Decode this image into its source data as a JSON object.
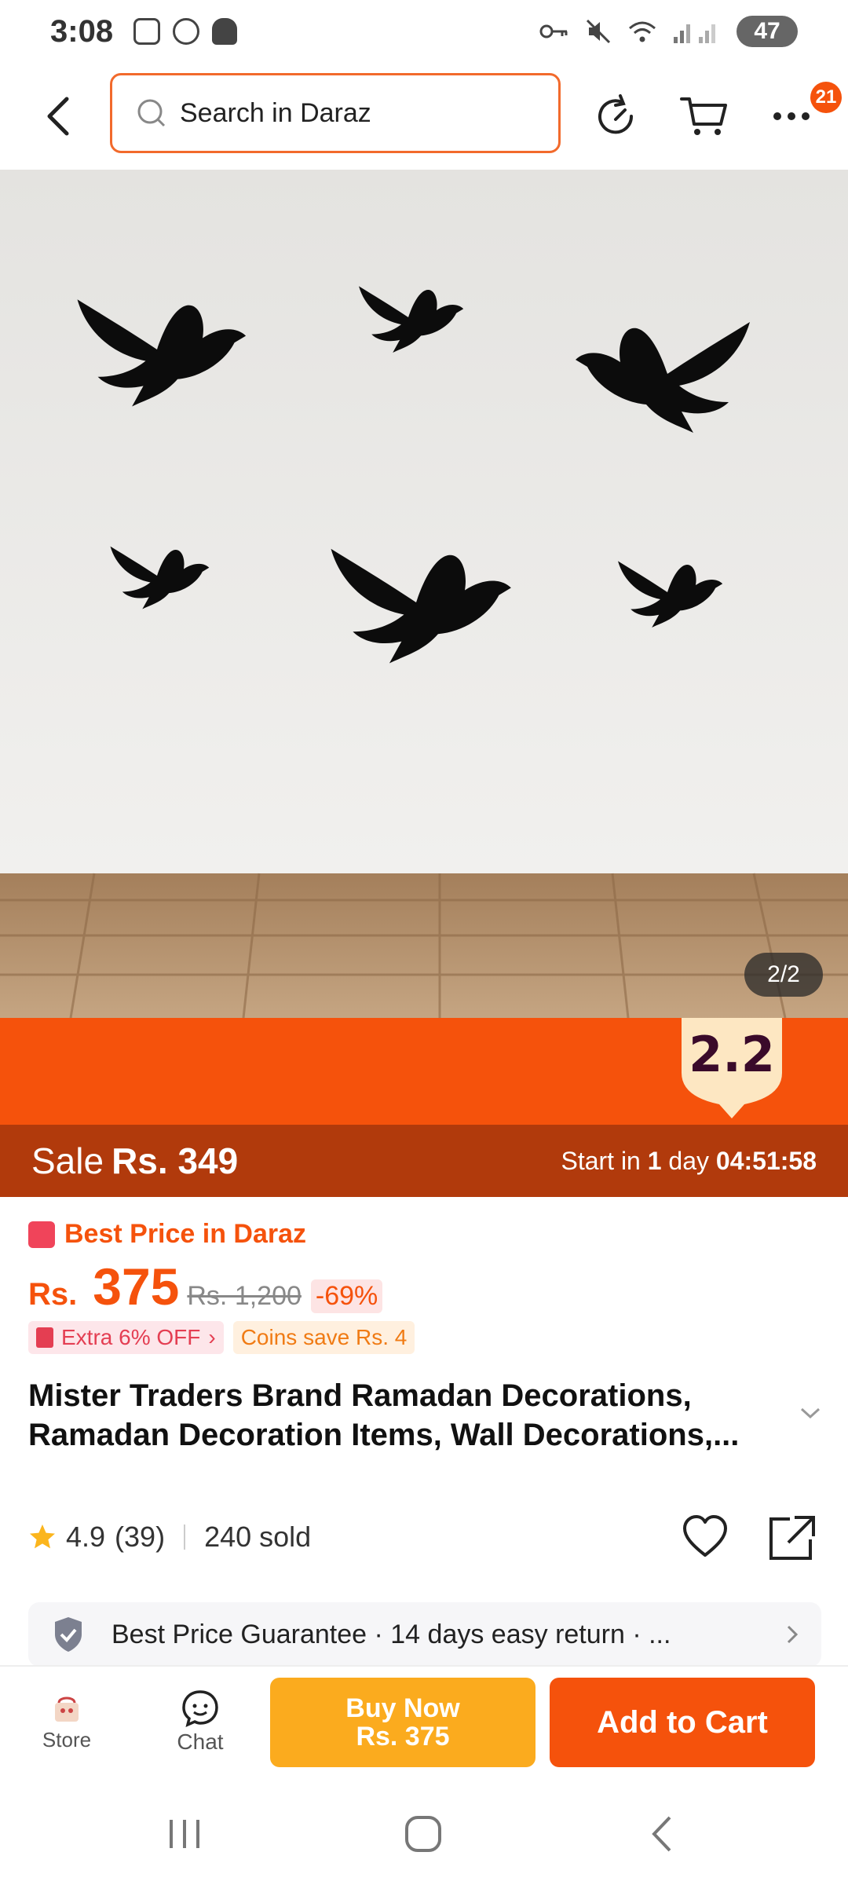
{
  "status_bar": {
    "time": "3:08",
    "battery": "47"
  },
  "header": {
    "search_placeholder": "Search in Daraz",
    "cart_badge": "21"
  },
  "gallery": {
    "counter": "2/2"
  },
  "campaign": {
    "tag": "2.2",
    "sale_label": "Sale",
    "sale_price": "Rs. 349",
    "start_prefix": "Start in",
    "start_days": "1",
    "start_unit": "day",
    "countdown": "04:51:58"
  },
  "price": {
    "best_label": "Best Price in Daraz",
    "currency": "Rs.",
    "amount": "375",
    "original": "Rs. 1,200",
    "discount": "-69%"
  },
  "chips": {
    "extra": "Extra 6% OFF",
    "coins": "Coins save Rs. 4"
  },
  "product": {
    "title": "Mister Traders Brand Ramadan Decorations, Ramadan Decoration Items, Wall Decorations,..."
  },
  "rating": {
    "score": "4.9",
    "count": "(39)",
    "sold": "240 sold"
  },
  "guarantee": {
    "text": "Best Price Guarantee  ·  14 days easy return  ·  ..."
  },
  "bottom_bar": {
    "store": "Store",
    "chat": "Chat",
    "buy_now": "Buy Now",
    "buy_now_price": "Rs. 375",
    "add_to_cart": "Add to Cart"
  },
  "colors": {
    "brand": "#f5520c",
    "buy_now": "#fbab1e",
    "sale_bar": "#b13a0c"
  }
}
